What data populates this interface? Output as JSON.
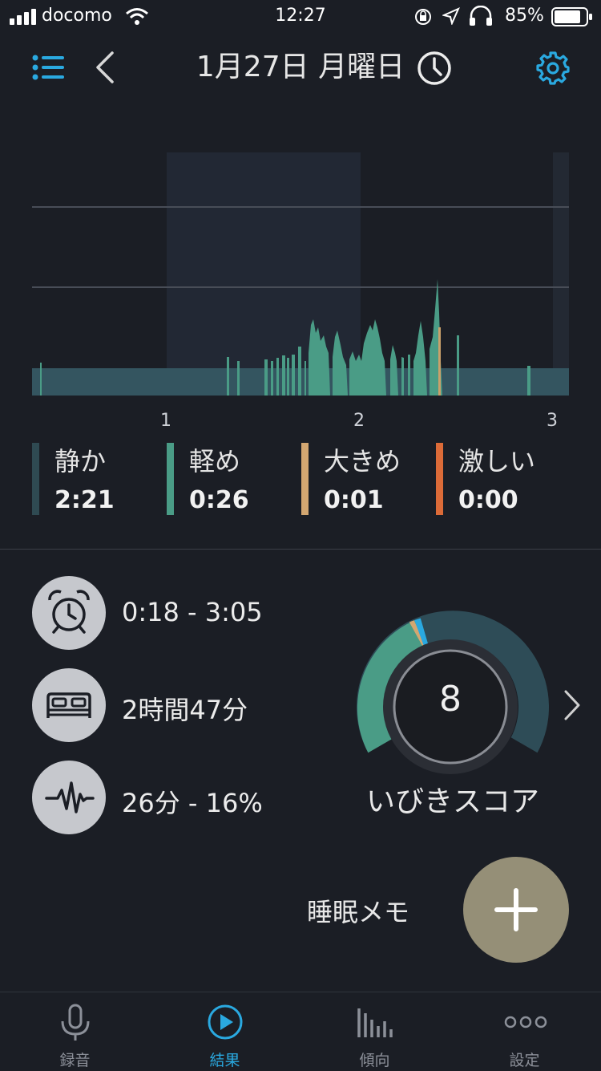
{
  "status_bar": {
    "carrier": "docomo",
    "time": "12:27",
    "battery_percent": "85%",
    "battery_level": 0.85
  },
  "header": {
    "title": "1月27日 月曜日",
    "accent_color": "#2aa9e0"
  },
  "chart_data": {
    "type": "area",
    "x_tick_labels": [
      "1",
      "2",
      "3"
    ],
    "gridlines": true,
    "series": [
      {
        "name": "静か",
        "color": "#345560"
      },
      {
        "name": "軽め",
        "color": "#4a9c86"
      },
      {
        "name": "大きめ",
        "color": "#c9a06a"
      },
      {
        "name": "激しい",
        "color": "#d86a3c"
      }
    ]
  },
  "legend": [
    {
      "name": "静か",
      "value": "2:21",
      "color": "#2f4a52"
    },
    {
      "name": "軽め",
      "value": "0:26",
      "color": "#4a9c86"
    },
    {
      "name": "大きめ",
      "value": "0:01",
      "color": "#d3a771"
    },
    {
      "name": "激しい",
      "value": "0:00",
      "color": "#dc6b38"
    }
  ],
  "stats": {
    "time_range": "0:18 - 3:05",
    "duration": "2時間47分",
    "snore_time": "26分 - 16%"
  },
  "score": {
    "value": "8",
    "label": "いびきスコア"
  },
  "memo": {
    "label": "睡眠メモ"
  },
  "tabs": [
    {
      "label": "録音",
      "icon": "microphone-icon",
      "active": false
    },
    {
      "label": "結果",
      "icon": "play-icon",
      "active": true
    },
    {
      "label": "傾向",
      "icon": "bar-chart-icon",
      "active": false
    },
    {
      "label": "設定",
      "icon": "more-icon",
      "active": false
    }
  ]
}
